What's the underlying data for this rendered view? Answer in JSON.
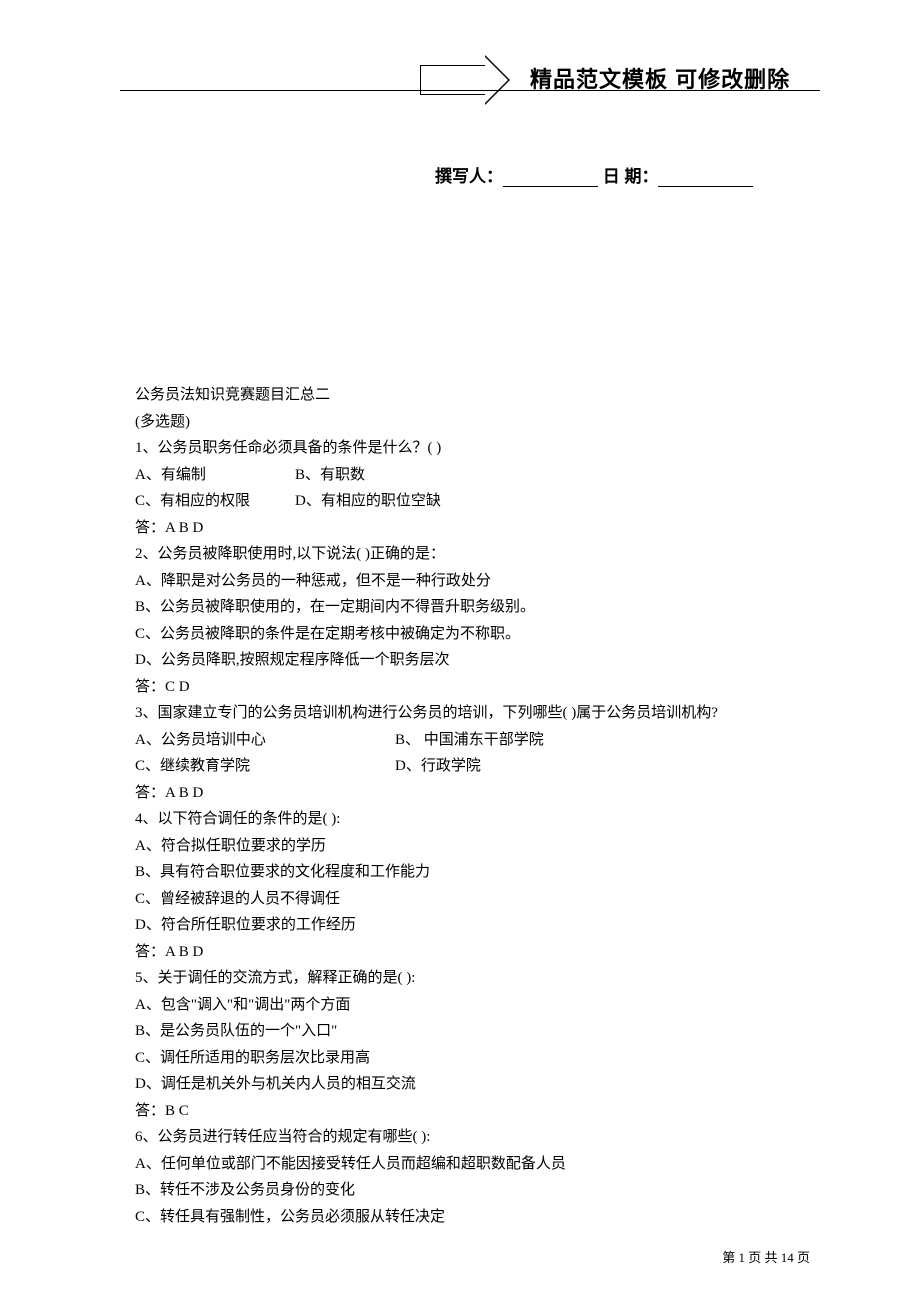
{
  "header": {
    "banner": "精品范文模板 可修改删除"
  },
  "meta": {
    "author_label": "撰写人：",
    "date_label": "日  期："
  },
  "content": {
    "title": "公务员法知识竞赛题目汇总二",
    "subtitle": "(多选题)",
    "q1": {
      "stem": "1、公务员职务任命必须具备的条件是什么？(       )",
      "optA": "A、有编制",
      "optB": "B、有职数",
      "optC": "C、有相应的权限",
      "optD": "D、有相应的职位空缺",
      "ans": "答：A B D"
    },
    "q2": {
      "stem": "2、公务员被降职使用时,以下说法(      )正确的是：",
      "optA": "A、降职是对公务员的一种惩戒，但不是一种行政处分",
      "optB": "B、公务员被降职使用的，在一定期间内不得晋升职务级别。",
      "optC": "C、公务员被降职的条件是在定期考核中被确定为不称职。",
      "optD": "D、公务员降职,按照规定程序降低一个职务层次",
      "ans": "答：C   D"
    },
    "q3": {
      "stem": "3、国家建立专门的公务员培训机构进行公务员的培训，下列哪些(      )属于公务员培训机构?",
      "optA": "A、公务员培训中心",
      "optB": "B、 中国浦东干部学院",
      "optC": "C、继续教育学院",
      "optD": "D、行政学院",
      "ans": "答：A B D"
    },
    "q4": {
      "stem": "4、以下符合调任的条件的是(       ):",
      "optA": "A、符合拟任职位要求的学历",
      "optB": "B、具有符合职位要求的文化程度和工作能力",
      "optC": "C、曾经被辞退的人员不得调任",
      "optD": "D、符合所任职位要求的工作经历",
      "ans": "答：A B D"
    },
    "q5": {
      "stem": "5、关于调任的交流方式，解释正确的是(       ):",
      "optA": "A、包含\"调入\"和\"调出\"两个方面",
      "optB": "B、是公务员队伍的一个\"入口\"",
      "optC": "C、调任所适用的职务层次比录用高",
      "optD": "D、调任是机关外与机关内人员的相互交流",
      "ans": "答：B C"
    },
    "q6": {
      "stem": "6、公务员进行转任应当符合的规定有哪些(        ):",
      "optA": "A、任何单位或部门不能因接受转任人员而超编和超职数配备人员",
      "optB": "B、转任不涉及公务员身份的变化",
      "optC": "C、转任具有强制性，公务员必须服从转任决定"
    }
  },
  "footer": {
    "prefix": "第 ",
    "current": "1",
    "mid": " 页 共 ",
    "total": "14",
    "suffix": " 页"
  }
}
